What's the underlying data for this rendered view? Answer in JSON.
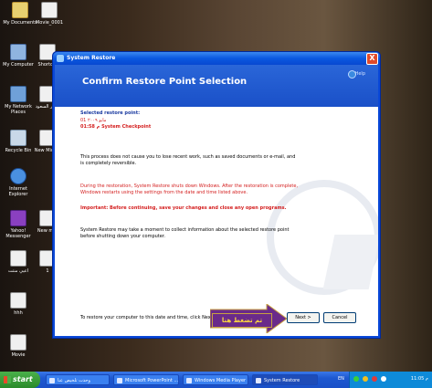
{
  "desktop": {
    "icons": [
      {
        "label": "My Documents"
      },
      {
        "label": "Movie_0001"
      },
      {
        "label": "My Computer"
      },
      {
        "label": "Shortc..."
      },
      {
        "label": "My Network Places"
      },
      {
        "label": "إختبر السعود"
      },
      {
        "label": "Recycle Bin"
      },
      {
        "label": "New Micros"
      },
      {
        "label": "Internet Explorer"
      },
      {
        "label": "Yahoo! Messenger"
      },
      {
        "label": "New m..."
      },
      {
        "label": "اعيي منتت"
      },
      {
        "label": "1"
      },
      {
        "label": "hhh"
      },
      {
        "label": "Movie"
      }
    ]
  },
  "window": {
    "title": "System Restore",
    "close_label": "X",
    "header_title": "Confirm Restore Point Selection",
    "help_label": "Help",
    "selected_label": "Selected restore point:",
    "selected_date": "01 مايو ٢٠٠٩",
    "selected_time": "01:58 م System Checkpoint",
    "para1": "This process does not cause you to lose recent work, such as saved documents or e-mail, and is completely reversible.",
    "para2": "During the restoration, System Restore shuts down Windows. After the restoration is complete, Windows restarts using the settings from the date and time listed above.",
    "para3": "Important: Before continuing, save your changes and close any open programs.",
    "para4": "System Restore may take a moment to collect information about the selected restore point before shutting down your computer.",
    "footer_text": "To restore your computer to this date and time, click Next.",
    "back_label": "< Back",
    "next_label": "Next >",
    "cancel_label": "Cancel",
    "annotation": "تم تضغط هنا"
  },
  "taskbar": {
    "start_label": "start",
    "buttons": [
      {
        "label": "وحدت تلخيص عنا"
      },
      {
        "label": "Microsoft PowerPoint ..."
      },
      {
        "label": "Windows Media Player"
      },
      {
        "label": "System Restore"
      }
    ],
    "lang": "EN",
    "clock": "11:05 م"
  },
  "colors": {
    "xp_blue": "#0a48d8",
    "accent_red": "#d42020",
    "start_green": "#2a8a2a",
    "annotation_purple": "#6a2a8a"
  }
}
